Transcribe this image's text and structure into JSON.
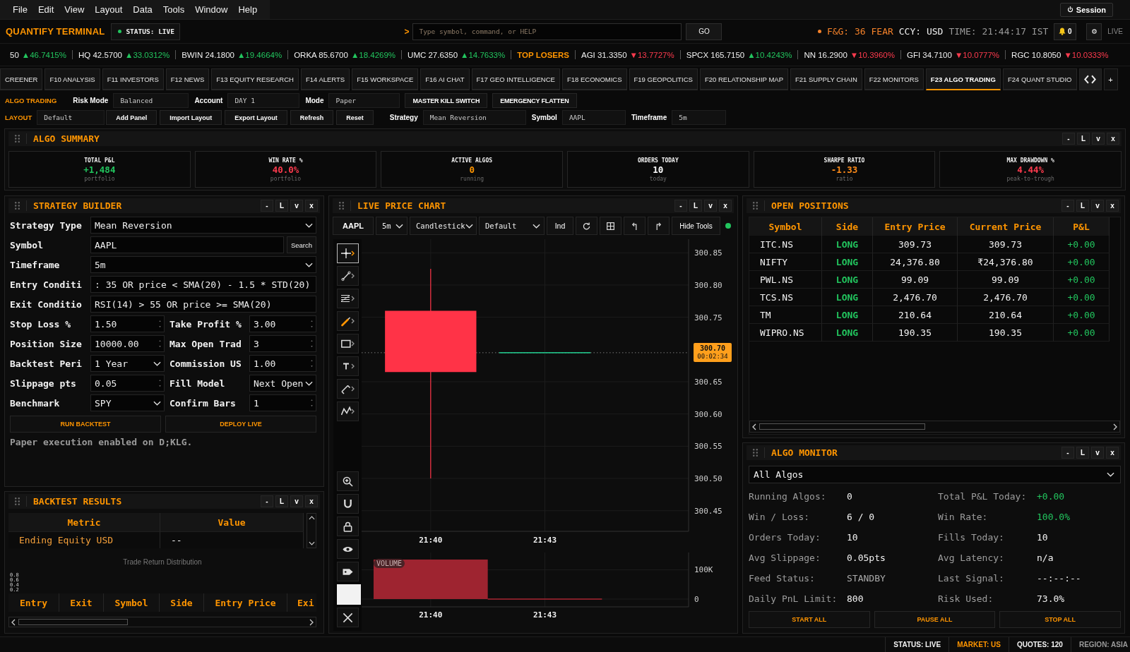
{
  "menu": [
    "File",
    "Edit",
    "View",
    "Layout",
    "Data",
    "Tools",
    "Window",
    "Help"
  ],
  "session": "Session",
  "header": {
    "brand": "QUANTIFY TERMINAL",
    "status": "STATUS: LIVE",
    "prompt": ">",
    "command": {
      "placeholder": "Type symbol, command, or HELP"
    },
    "go": "GO",
    "fear_greed": "F&G: 36 FEAR",
    "currency": "CCY: USD",
    "time": "TIME: 21:44:17 IST",
    "alerts": "0",
    "live": "LIVE"
  },
  "ticker": [
    {
      "kind": "quote",
      "quote": "50",
      "change": "▲46.7415%",
      "up": true
    },
    {
      "kind": "quote",
      "quote": "HQ 42.5700",
      "change": "▲33.0312%",
      "up": true
    },
    {
      "kind": "quote",
      "quote": "BWIN 24.1800",
      "change": "▲19.4664%",
      "up": true
    },
    {
      "kind": "quote",
      "quote": "ORKA 85.6700",
      "change": "▲18.4269%",
      "up": true
    },
    {
      "kind": "quote",
      "quote": "UMC 27.6350",
      "change": "▲14.7633%",
      "up": true
    },
    {
      "kind": "heading",
      "text": "TOP LOSERS"
    },
    {
      "kind": "quote",
      "quote": "AGI 31.3350",
      "change": "▼13.7727%",
      "up": false
    },
    {
      "kind": "quote",
      "quote": "SPCX 165.7150",
      "change": "▲10.4243%",
      "up": true
    },
    {
      "kind": "quote",
      "quote": "NN 16.2900",
      "change": "▼10.3960%",
      "up": false
    },
    {
      "kind": "quote",
      "quote": "GFI 34.7100",
      "change": "▼10.0777%",
      "up": false
    },
    {
      "kind": "quote",
      "quote": "RGC 10.8050",
      "change": "▼10.0333%",
      "up": false
    }
  ],
  "function_tabs": {
    "tabs": [
      {
        "label": "CREENER",
        "selected": false
      },
      {
        "label": "F10 ANALYSIS",
        "selected": false
      },
      {
        "label": "F11 INVESTORS",
        "selected": false
      },
      {
        "label": "F12 NEWS",
        "selected": false
      },
      {
        "label": "F13 EQUITY RESEARCH",
        "selected": false
      },
      {
        "label": "F14 ALERTS",
        "selected": false
      },
      {
        "label": "F15 WORKSPACE",
        "selected": false
      },
      {
        "label": "F16 AI CHAT",
        "selected": false
      },
      {
        "label": "F17 GEO INTELLIGENCE",
        "selected": false
      },
      {
        "label": "F18 ECONOMICS",
        "selected": false
      },
      {
        "label": "F19 GEOPOLITICS",
        "selected": false
      },
      {
        "label": "F20 RELATIONSHIP MAP",
        "selected": false
      },
      {
        "label": "F21 SUPPLY CHAIN",
        "selected": false
      },
      {
        "label": "F22 MONITORS",
        "selected": false
      },
      {
        "label": "F23 ALGO TRADING",
        "selected": true
      },
      {
        "label": "F24 QUANT STUDIO",
        "selected": false
      }
    ],
    "add": "+"
  },
  "algo_bar": {
    "title": "ALGO TRADING",
    "fields": [
      {
        "label": "Risk Mode",
        "value": "Balanced"
      },
      {
        "label": "Account",
        "value": "DAY 1"
      },
      {
        "label": "Mode",
        "value": "Paper"
      }
    ],
    "buttons": [
      "MASTER KILL SWITCH",
      "EMERGENCY FLATTEN"
    ]
  },
  "layout_bar": {
    "title": "LAYOUT",
    "layout": "Default",
    "buttons": [
      "Add Panel",
      "Import Layout",
      "Export Layout",
      "Refresh",
      "Reset"
    ],
    "fields": [
      {
        "label": "Strategy",
        "value": "Mean Reversion"
      },
      {
        "label": "Symbol",
        "value": "AAPL"
      },
      {
        "label": "Timeframe",
        "value": "5m"
      }
    ]
  },
  "algo_summary": {
    "title": "ALGO SUMMARY",
    "controls": [
      "-",
      "L",
      "v",
      "x"
    ],
    "cards": [
      {
        "label": "TOTAL P&L",
        "value": "+1,484",
        "color": "#22c55e",
        "note": "portfolio"
      },
      {
        "label": "WIN RATE %",
        "value": "40.0%",
        "color": "#ff3b4e",
        "note": "portfolio"
      },
      {
        "label": "ACTIVE ALGOS",
        "value": "0",
        "color": "#ff9500",
        "note": "running"
      },
      {
        "label": "ORDERS TODAY",
        "value": "10",
        "color": "#ffffff",
        "note": "today"
      },
      {
        "label": "SHARPE RATIO",
        "value": "-1.33",
        "color": "#ff8c1a",
        "note": "ratio"
      },
      {
        "label": "MAX DRAWDOWN %",
        "value": "4.44%",
        "color": "#ff3b4e",
        "note": "peak-to-trough"
      }
    ]
  },
  "strategy_builder": {
    "title": "STRATEGY BUILDER",
    "controls": [
      "-",
      "L",
      "v",
      "x"
    ],
    "rows": [
      {
        "fields": [
          {
            "label": "Strategy Type",
            "value": "Mean Reversion",
            "kind": "select"
          }
        ]
      },
      {
        "fields": [
          {
            "label": "Symbol",
            "value": "AAPL",
            "kind": "search",
            "button": "Search"
          }
        ]
      },
      {
        "fields": [
          {
            "label": "Timeframe",
            "value": "5m",
            "kind": "select"
          }
        ]
      },
      {
        "fields": [
          {
            "label": "Entry Conditi",
            "value": ": 35 OR price < SMA(20) - 1.5 * STD(20)",
            "kind": "text"
          }
        ]
      },
      {
        "fields": [
          {
            "label": "Exit Conditio",
            "value": "RSI(14) > 55 OR price >= SMA(20)",
            "kind": "text"
          }
        ]
      },
      {
        "fields": [
          {
            "label": "Stop Loss %",
            "value": "1.50",
            "kind": "number"
          },
          {
            "label": "Take Profit %",
            "value": "3.00",
            "kind": "number"
          }
        ]
      },
      {
        "fields": [
          {
            "label": "Position Size",
            "value": "10000.00",
            "kind": "number"
          },
          {
            "label": "Max Open Trad",
            "value": "3",
            "kind": "number"
          }
        ]
      },
      {
        "fields": [
          {
            "label": "Backtest Peri",
            "value": "1 Year",
            "kind": "select"
          },
          {
            "label": "Commission US",
            "value": "1.00",
            "kind": "number"
          }
        ]
      },
      {
        "fields": [
          {
            "label": "Slippage pts",
            "value": "0.05",
            "kind": "number"
          },
          {
            "label": "Fill Model",
            "value": "Next Open",
            "kind": "select"
          }
        ]
      },
      {
        "fields": [
          {
            "label": "Benchmark",
            "value": "SPY",
            "kind": "select"
          },
          {
            "label": "Confirm Bars",
            "value": "1",
            "kind": "number"
          }
        ]
      }
    ],
    "buttons": [
      "RUN BACKTEST",
      "DEPLOY LIVE"
    ],
    "message": "Paper execution enabled on D;KLG."
  },
  "backtest_results": {
    "title": "BACKTEST RESULTS",
    "controls": [
      "-",
      "L",
      "v",
      "x"
    ],
    "metrics": {
      "columns": [
        "Metric",
        "Value"
      ],
      "rows": [
        {
          "metric": "Ending Equity USD",
          "value": "--"
        }
      ]
    },
    "distribution": {
      "title": "Trade Return Distribution",
      "axis_labels": [
        "0.8",
        "0.6",
        "0.4",
        "0.2"
      ]
    },
    "trades": {
      "columns": [
        "Entry",
        "Exit",
        "Symbol",
        "Side",
        "Entry Price",
        "Exi"
      ]
    }
  },
  "price_chart": {
    "title": "LIVE PRICE CHART",
    "controls": [
      "-",
      "L",
      "v",
      "x"
    ],
    "toolbar": {
      "symbol": "AAPL",
      "timeframe": "5m",
      "chart_type": "Candlestick",
      "template": "Default",
      "indicators": "Ind",
      "hide_tools": "Hide Tools",
      "connected": true
    },
    "tools": [
      {
        "kind": "crosshair",
        "selected": true
      },
      {
        "kind": "trend-line",
        "selected": false
      },
      {
        "kind": "fib",
        "selected": false
      },
      {
        "kind": "brush",
        "selected": false
      },
      {
        "kind": "rectangle",
        "selected": false
      },
      {
        "kind": "text",
        "selected": false
      },
      {
        "kind": "ruler",
        "selected": false
      },
      {
        "kind": "pattern",
        "selected": false
      }
    ],
    "view_tools": [
      {
        "kind": "zoom"
      },
      {
        "kind": "magnet"
      },
      {
        "kind": "lock"
      },
      {
        "kind": "eye"
      },
      {
        "kind": "tag"
      },
      {
        "kind": "swatch",
        "color": "#f2f2f2"
      },
      {
        "kind": "remove"
      }
    ],
    "price_axis": [
      "300.85",
      "300.80",
      "300.75",
      "300.65",
      "300.60",
      "300.55",
      "300.50",
      "300.45"
    ],
    "time_axis": [
      "21:40",
      "21:43"
    ],
    "last_price": {
      "price": "300.70",
      "countdown": "00:02:34"
    },
    "volume": {
      "label": "VOLUME",
      "chart_data": {
        "type": "bar",
        "x": [
          "21:40",
          "21:43"
        ],
        "values": [
          135000,
          0
        ],
        "ylim": [
          -26500,
          159000
        ],
        "yticks": [
          {
            "value": 100000,
            "label": "100K"
          },
          {
            "value": 0,
            "label": "0"
          }
        ],
        "grid": true
      }
    }
  },
  "open_positions": {
    "title": "OPEN POSITIONS",
    "controls": [
      "-",
      "L",
      "v",
      "x"
    ],
    "columns": [
      "Symbol",
      "Side",
      "Entry Price",
      "Current Price",
      "P&L"
    ],
    "rows": [
      {
        "symbol": "ITC.NS",
        "side": "LONG",
        "entry_price": "309.73",
        "current_price": "309.73",
        "pnl": "+0.00"
      },
      {
        "symbol": "NIFTY",
        "side": "LONG",
        "entry_price": "24,376.80",
        "current_price": "₹24,376.80",
        "pnl": "+0.00"
      },
      {
        "symbol": "PWL.NS",
        "side": "LONG",
        "entry_price": "99.09",
        "current_price": "99.09",
        "pnl": "+0.00"
      },
      {
        "symbol": "TCS.NS",
        "side": "LONG",
        "entry_price": "2,476.70",
        "current_price": "2,476.70",
        "pnl": "+0.00"
      },
      {
        "symbol": "TM",
        "side": "LONG",
        "entry_price": "210.64",
        "current_price": "210.64",
        "pnl": "+0.00"
      },
      {
        "symbol": "WIPRO.NS",
        "side": "LONG",
        "entry_price": "190.35",
        "current_price": "190.35",
        "pnl": "+0.00"
      }
    ]
  },
  "algo_monitor": {
    "title": "ALGO MONITOR",
    "controls": [
      "-",
      "L",
      "v",
      "x"
    ],
    "filter": "All Algos",
    "stats": [
      {
        "label": "Running Algos:",
        "value": "0"
      },
      {
        "label": "Total P&L Today:",
        "value": "+0.00",
        "color": "#22c55e"
      },
      {
        "label": "Win / Loss:",
        "value": "6 / 0"
      },
      {
        "label": "Win Rate:",
        "value": "100.0%",
        "color": "#22c55e"
      },
      {
        "label": "Orders Today:",
        "value": "10"
      },
      {
        "label": "Fills Today:",
        "value": "10"
      },
      {
        "label": "Avg Slippage:",
        "value": "0.05pts"
      },
      {
        "label": "Avg Latency:",
        "value": "n/a"
      },
      {
        "label": "Feed Status:",
        "value": "STANDBY",
        "color": "#aaaaaa"
      },
      {
        "label": "Last Signal:",
        "value": "--:--:--"
      },
      {
        "label": "Daily PnL Limit:",
        "value": "800"
      },
      {
        "label": "Risk Used:",
        "value": "73.0%"
      }
    ],
    "buttons": [
      "START ALL",
      "PAUSE ALL",
      "STOP ALL"
    ]
  },
  "status_bar": [
    {
      "text": "STATUS: LIVE",
      "color": "#f2f2f2"
    },
    {
      "text": "MARKET: US",
      "color": "#ff9500"
    },
    {
      "text": "QUOTES: 120",
      "color": "#f2f2f2"
    },
    {
      "text": "REGION: ASIA",
      "color": "#9a9a9a"
    }
  ]
}
